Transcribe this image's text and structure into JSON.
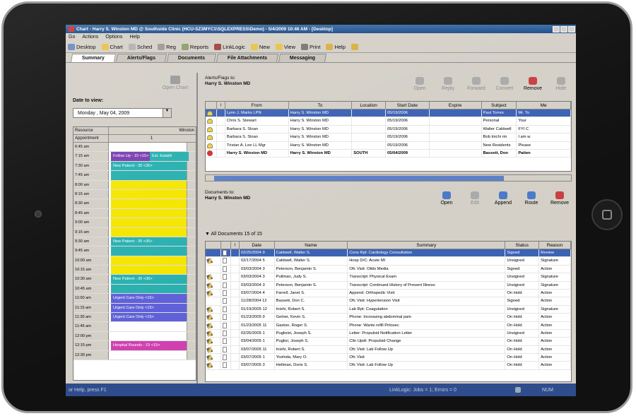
{
  "window": {
    "title": "Chart - Harry S. Winston MD @ Southside Clinic (HCU-SZ3MYC1\\SQLEXPRESS\\Demo) - 5/4/2009 10:46 AM - [Desktop]"
  },
  "menu": [
    "Go",
    "Actions",
    "Options",
    "Help"
  ],
  "toolbar": [
    {
      "label": "Desktop",
      "icon": "desktop-icon",
      "color": "#6a8ac7"
    },
    {
      "label": "Chart",
      "icon": "folder-icon",
      "color": "#e8c24a"
    },
    {
      "label": "Sched",
      "icon": "clock-icon",
      "color": "#b0b0b0"
    },
    {
      "label": "Reg",
      "icon": "register-icon",
      "color": "#9a9a9a"
    },
    {
      "label": "Reports",
      "icon": "reports-icon",
      "color": "#8aa06a"
    },
    {
      "label": "LinkLogic",
      "icon": "link-icon",
      "color": "#a04040"
    },
    {
      "label": "New",
      "icon": "new-icon",
      "color": "#e8c24a"
    },
    {
      "label": "View",
      "icon": "view-icon",
      "color": "#e8c24a"
    },
    {
      "label": "Print",
      "icon": "print-icon",
      "color": "#777777"
    },
    {
      "label": "Help",
      "icon": "help-icon",
      "color": "#d8b040"
    },
    {
      "label": "",
      "icon": "glasses-icon",
      "color": "#d8b040"
    }
  ],
  "tabs": [
    "Summary",
    "Alerts/Flags",
    "Documents",
    "File Attachments",
    "Messaging"
  ],
  "left": {
    "open_chart": "Open Chart",
    "date_label": "Date to view:",
    "date_value": "Monday ,    May    04, 2009",
    "resource_label": "Resource",
    "resource_value": "Winston",
    "appointment_label": "Appointment",
    "appointment_value": "1",
    "times": [
      "6:45 am",
      "7:15 am",
      "7:30 am",
      "7:45 am",
      "8:00 am",
      "8:15 am",
      "8:30 am",
      "8:45 am",
      "9:00 am",
      "9:15 am",
      "9:30 am",
      "9:45 am",
      "10:00 am",
      "10:15 am",
      "10:30 am",
      "10:45 am",
      "11:00 am",
      "11:15 am",
      "11:30 am",
      "11:45 am",
      "12:00 pm",
      "12:15 pm",
      "12:30 pm"
    ],
    "appointments": [
      {
        "row": 1,
        "text": "Follow Up - 15 <15>",
        "color": "#7a3fb0"
      },
      {
        "row": 1,
        "text": "Est. Establi",
        "color": "#2ab0b0"
      },
      {
        "row": 2,
        "text": "New Patient - 30 <30>",
        "color": "#2ab0b0"
      },
      {
        "row": 3,
        "text": "",
        "color": "#2ab0b0"
      },
      {
        "row": 4,
        "text": "",
        "color": "#f5e600"
      },
      {
        "row": 5,
        "text": "",
        "color": "#f5e600"
      },
      {
        "row": 6,
        "text": "",
        "color": "#f5e600"
      },
      {
        "row": 7,
        "text": "",
        "color": "#f5e600"
      },
      {
        "row": 8,
        "text": "",
        "color": "#f5e600"
      },
      {
        "row": 9,
        "text": "",
        "color": "#f5e600"
      },
      {
        "row": 10,
        "text": "New Patient - 30 <30>",
        "color": "#2ab0b0"
      },
      {
        "row": 11,
        "text": "",
        "color": "#2ab0b0"
      },
      {
        "row": 12,
        "text": "",
        "color": "#f5e600"
      },
      {
        "row": 13,
        "text": "",
        "color": "#f5e600"
      },
      {
        "row": 14,
        "text": "New Patient - 30 <30>",
        "color": "#2ab0b0"
      },
      {
        "row": 15,
        "text": "",
        "color": "#2ab0b0"
      },
      {
        "row": 16,
        "text": "Urgent Care Only <15>",
        "color": "#6060d8"
      },
      {
        "row": 17,
        "text": "Urgent Care Only <15>",
        "color": "#6060d8"
      },
      {
        "row": 18,
        "text": "Urgent Care Only <15>",
        "color": "#6060d8"
      },
      {
        "row": 21,
        "text": "Hospital Rounds - 15 <15>",
        "color": "#d040b0"
      }
    ]
  },
  "alerts": {
    "title_line1": "Alerts/Flags to:",
    "title_line2": "Harry S. Winston MD",
    "actions": [
      {
        "label": "Open",
        "enabled": false
      },
      {
        "label": "Reply",
        "enabled": false
      },
      {
        "label": "Forward",
        "enabled": false
      },
      {
        "label": "Convert",
        "enabled": false
      },
      {
        "label": "Remove",
        "enabled": true
      },
      {
        "label": "Hide",
        "enabled": false
      }
    ],
    "columns": [
      "",
      "!",
      "From",
      "To",
      "Location",
      "Start Date",
      "Expire",
      "Subject",
      "Me"
    ],
    "rows": [
      {
        "from": "Lynn J. Marks LPN",
        "to": "Harry S. Winston MD",
        "location": "",
        "start": "05/19/2006",
        "expire": "",
        "subject": "Paul Torres",
        "me": "Mr. To",
        "selected": true
      },
      {
        "from": "Chris S. Stewart",
        "to": "Harry S. Winston MD",
        "location": "",
        "start": "05/19/2006",
        "expire": "",
        "subject": "Personal",
        "me": "Your"
      },
      {
        "from": "Barbara S. Sloan",
        "to": "Harry S. Winston MD",
        "location": "",
        "start": "05/19/2006",
        "expire": "",
        "subject": "Walter Caldwell",
        "me": "FYI C"
      },
      {
        "from": "Barbara S. Sloan",
        "to": "Harry S. Winston MD",
        "location": "",
        "start": "05/19/2006",
        "expire": "",
        "subject": "Bob Inichi rm",
        "me": "I am w"
      },
      {
        "from": "Tristan A. Lee LL Mgr",
        "to": "Harry S. Winston MD",
        "location": "",
        "start": "05/19/2006",
        "expire": "",
        "subject": "New Residents",
        "me": "Please"
      },
      {
        "from": "Harry S. Winston MD",
        "to": "Harry S. Winston MD",
        "location": "SOUTH",
        "start": "05/04/2009",
        "expire": "",
        "subject": "Bassett, Don",
        "me": "Patien",
        "bold": true
      }
    ]
  },
  "documents": {
    "title_line1": "Documents to:",
    "title_line2": "Harry S. Winston MD",
    "all_label": "All Documents 15 of 15",
    "actions": [
      {
        "label": "Open",
        "enabled": true
      },
      {
        "label": "Edit",
        "enabled": false
      },
      {
        "label": "Append",
        "enabled": true
      },
      {
        "label": "Route",
        "enabled": true
      },
      {
        "label": "Remove",
        "enabled": true
      }
    ],
    "columns": [
      "",
      "",
      "!",
      "Date",
      "Name",
      "Summary",
      "Status",
      "Reason"
    ],
    "rows": [
      {
        "date": "02/25/2004 9",
        "name": "Caldwell, Walter S.",
        "summary": "Cons Rpt: Cardiology Consultation",
        "status": "Signed",
        "reason": "Review",
        "selected": true,
        "pen": false
      },
      {
        "date": "02/17/2004 5",
        "name": "Caldwell, Walter S.",
        "summary": "Hosp D/C: Acute MI",
        "status": "Unsigned",
        "reason": "Signature",
        "pen": true
      },
      {
        "date": "03/03/2004 3",
        "name": "Peterson, Benjamin S.",
        "summary": "Ofc Visit: Otitis Media",
        "status": "Signed",
        "reason": "Action",
        "pen": false
      },
      {
        "date": "03/03/2004 3",
        "name": "Pullman, Judy S.",
        "summary": "Transcript: Physical Exam",
        "status": "Unsigned",
        "reason": "Signature",
        "pen": true
      },
      {
        "date": "03/03/2004 3",
        "name": "Peterson, Benjamin S.",
        "summary": "Transcript: Continued History of Present Illness:",
        "status": "Unsigned",
        "reason": "Signature",
        "pen": true
      },
      {
        "date": "03/07/2004 4",
        "name": "Farrell, Janet S.",
        "summary": "Append: Orthopedic Visit",
        "status": "On Hold",
        "reason": "Action",
        "pen": true
      },
      {
        "date": "11/28/2004 12",
        "name": "Bassett, Don C.",
        "summary": "Ofc Visit: Hypertension Visit",
        "status": "Signed",
        "reason": "Action",
        "pen": false
      },
      {
        "date": "01/19/2005 12",
        "name": "Inishi, Robert S.",
        "summary": "Lab Rpt: Coagulation",
        "status": "Unsigned",
        "reason": "Signature",
        "pen": true
      },
      {
        "date": "01/23/2005 9",
        "name": "Gelner, Kevin S.",
        "summary": "Phone: Increasing abdominal pain",
        "status": "On Hold",
        "reason": "Action",
        "pen": true
      },
      {
        "date": "01/23/2005 11",
        "name": "Gaston, Roger S.",
        "summary": "Phone: Wants refill Prilosec",
        "status": "On Hold",
        "reason": "Action",
        "pen": true
      },
      {
        "date": "02/26/2005 1",
        "name": "Puglisisi, Joseph S.",
        "summary": "Letter: Propulsid Notification Letter",
        "status": "Unsigned",
        "reason": "Action",
        "pen": true
      },
      {
        "date": "03/04/2005 1",
        "name": "Puglisi, Joseph S.",
        "summary": "Clin Updt: Propulsid Change",
        "status": "On Hold",
        "reason": "Action",
        "pen": true
      },
      {
        "date": "03/07/2005 11",
        "name": "Inishi, Robert S.",
        "summary": "Ofc Visit: Lab Follow Up",
        "status": "On Hold",
        "reason": "Action",
        "pen": true
      },
      {
        "date": "03/07/2005 1",
        "name": "Yoshida, Mary O.",
        "summary": "Ofc Visit",
        "status": "On Hold",
        "reason": "Action",
        "pen": true
      },
      {
        "date": "03/07/2005 3",
        "name": "Hellman, Doris S.",
        "summary": "Ofc Visit: Lab Follow Up",
        "status": "On Hold",
        "reason": "Action",
        "pen": true
      }
    ]
  },
  "status": {
    "left": "or Help, press F1",
    "linklogic": "LinkLogic:  Jobs =   1;  Errors =   0",
    "num": "NUM"
  }
}
